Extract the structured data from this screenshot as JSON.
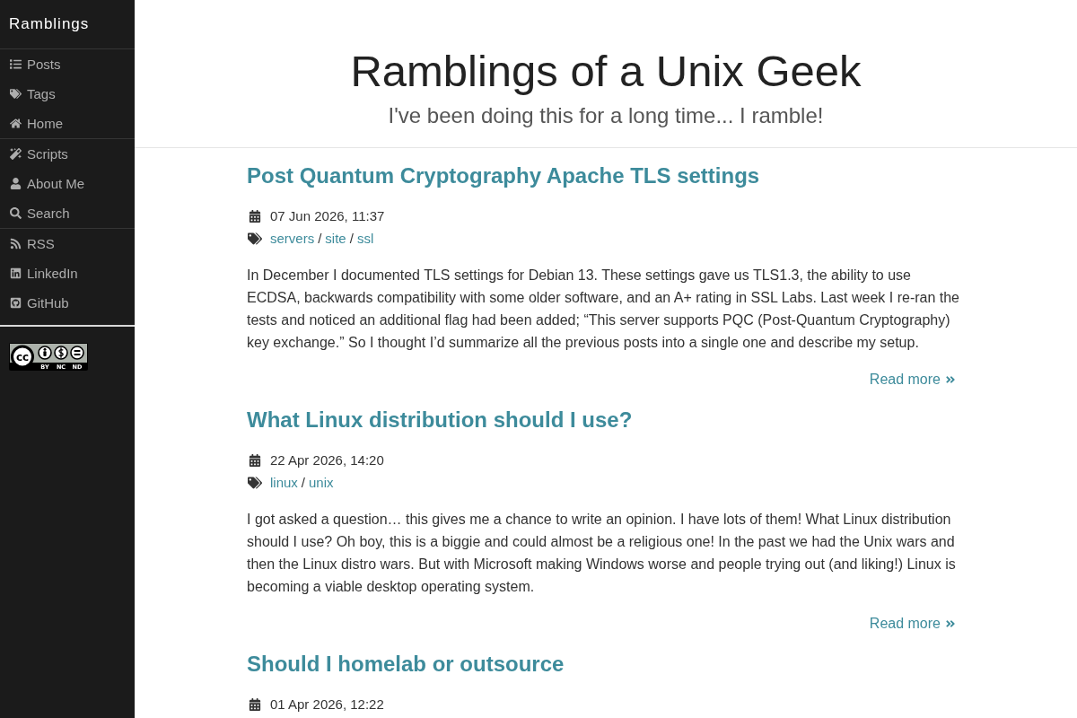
{
  "sidebar": {
    "brand": "Ramblings",
    "groups": [
      {
        "items": [
          {
            "label": "Posts"
          },
          {
            "label": "Tags"
          },
          {
            "label": "Home"
          }
        ]
      },
      {
        "items": [
          {
            "label": "Scripts"
          },
          {
            "label": "About Me"
          },
          {
            "label": "Search"
          }
        ]
      },
      {
        "items": [
          {
            "label": "RSS"
          },
          {
            "label": "LinkedIn"
          },
          {
            "label": "GitHub"
          }
        ]
      }
    ],
    "license_badge": {
      "mark": "cc",
      "terms": [
        "BY",
        "NC",
        "ND"
      ]
    }
  },
  "header": {
    "title": "Ramblings of a Unix Geek",
    "tagline": "I've been doing this for a long time... I ramble!"
  },
  "posts": [
    {
      "title": "Post Quantum Cryptography Apache TLS settings",
      "date": "07 Jun 2026, 11:37",
      "tags": [
        {
          "name": "servers"
        },
        {
          "separator": "/",
          "name": "site"
        },
        {
          "separator": "/",
          "name": "ssl"
        }
      ],
      "excerpt": "In December I documented TLS settings for Debian 13. These settings gave us TLS1.3, the ability to use ECDSA, backwards compatibility with some older software, and an A+ rating in SSL Labs. Last week I re-ran the tests and noticed an additional flag had been added; “This server supports PQC (Post-Quantum Cryptography) key exchange.” So I thought I’d summarize all the previous posts into a single one and describe my setup.",
      "read_more": "Read more"
    },
    {
      "title": "What Linux distribution should I use?",
      "date": "22 Apr 2026, 14:20",
      "tags": [
        {
          "name": "linux"
        },
        {
          "separator": "/",
          "name": "unix"
        }
      ],
      "excerpt": "I got asked a question… this gives me a chance to write an opinion. I have lots of them! What Linux distribution should I use? Oh boy, this is a biggie and could almost be a religious one! In the past we had the Unix wars and then the Linux distro wars. But with Microsoft making Windows worse and people trying out (and liking!) Linux is becoming a viable desktop operating system.",
      "read_more": "Read more"
    },
    {
      "title": "Should I homelab or outsource",
      "date": "01 Apr 2026, 12:22"
    }
  ]
}
